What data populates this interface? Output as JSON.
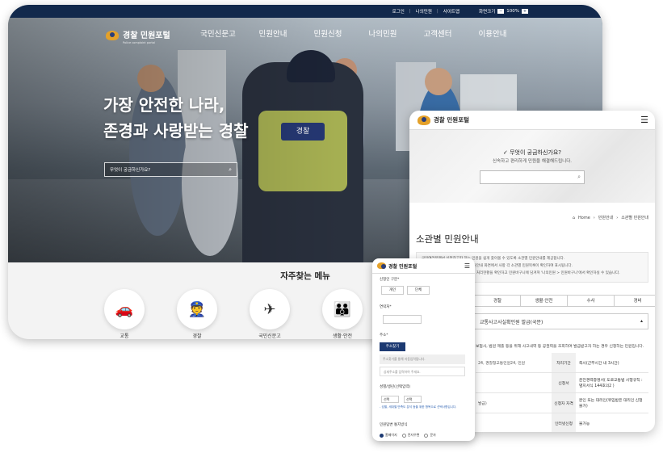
{
  "desktop": {
    "util_links": [
      "로그인",
      "나의민원",
      "사이트맵"
    ],
    "zoom_label": "화면크기",
    "zoom_value": "100%",
    "logo_title": "경찰 민원포털",
    "logo_sub": "Police complaint portal",
    "nav": [
      "국민신문고",
      "민원안내",
      "민원신청",
      "나의민원",
      "고객센터",
      "이용안내"
    ],
    "headline_1": "가장 안전한 나라,",
    "headline_2": "존경과 사랑받는 경찰",
    "vest_text": "경찰",
    "search_placeholder": "무엇이 궁금하신가요?",
    "quick_title": "자주찾는 메뉴",
    "quick_items": [
      {
        "label": "교통",
        "icon": "car-icon"
      },
      {
        "label": "경찰",
        "icon": "police-cap-icon"
      },
      {
        "label": "국민신문고",
        "icon": "paper-plane-icon"
      },
      {
        "label": "생활·안전",
        "icon": "family-icon"
      }
    ]
  },
  "tablet": {
    "logo_title": "경찰 민원포털",
    "question": "✓ 무엇이 궁금하신가요?",
    "question_sub": "신속하고 편리하게 민원을 해결해드립니다.",
    "breadcrumb": [
      "Home",
      "민원안내",
      "소관별 민원안내"
    ],
    "title": "소관별 민원안내",
    "info_lines": [
      "국민여러분께서 신청하고자 하는 민원을 쉽게 찾아볼 수 있도록 소관별 민원안내를 제공합니다.",
      "민원신청이 가능한 항목은 해당 민원안내 화면에서 사항 각 소관별 민원목록이 확인하여 표시됩니다.",
      "신청하신 민원은 나의민원 메뉴에서 처리현황을 확인하고 민원바구니에 담겨져 '나의민원 > 민원바구니'에서 확인하실 수 있습니다."
    ],
    "tabs": [
      "경찰",
      "생활·안전",
      "수사",
      "경비"
    ],
    "accordion_title": "교통사고사실확인원 발급(국문)",
    "accordion_desc": "보험사, 법원 제출 등을 위해 사고내역 등 공권력을 조회하여 발급받고자 하는 경우 신청하는 민원입니다.",
    "rows": [
      {
        "left": "24, 경찰청교통민원24, 민원",
        "key": "처리기간",
        "value": "즉시(근무시간 내 3시간)"
      },
      {
        "left": "",
        "key": "신청서",
        "value": "운전경력증명서( 도로교통법 시행규칙 : 별지서식 144호의2 )"
      },
      {
        "left": "발급)",
        "key": "신청자 자격",
        "value": "본인 또는 대리인(위임받은 대리인 신청 불가)"
      },
      {
        "left": "",
        "key": "인터넷신청",
        "value": "불가능"
      }
    ]
  },
  "phone": {
    "logo_title": "경찰 민원포털",
    "applicant_label": "신청인 구분*",
    "applicant_options": [
      "개인",
      "단체"
    ],
    "contact_label": "연락처*",
    "address_label": "주소*",
    "address_button": "주소찾기",
    "address_placeholder": "주소찾기를 통해 자동입력됩니다.",
    "address_detail_placeholder": "상세주소를 입력하여 주세요.",
    "birth_label": "성별/생년(선택입력)",
    "select_1": "선택",
    "select_2": "선택",
    "birth_note": "- 성별, 세대별 만족도 분석 등을 위한 항목으로 선택사항입니다.",
    "notify_label": "민원답변 통지방식",
    "notify_options": [
      "홈페이지",
      "전자우편",
      "문자"
    ]
  },
  "colors": {
    "navy": "#12294c",
    "gold": "#e4a12a",
    "button": "#1d3a72"
  }
}
